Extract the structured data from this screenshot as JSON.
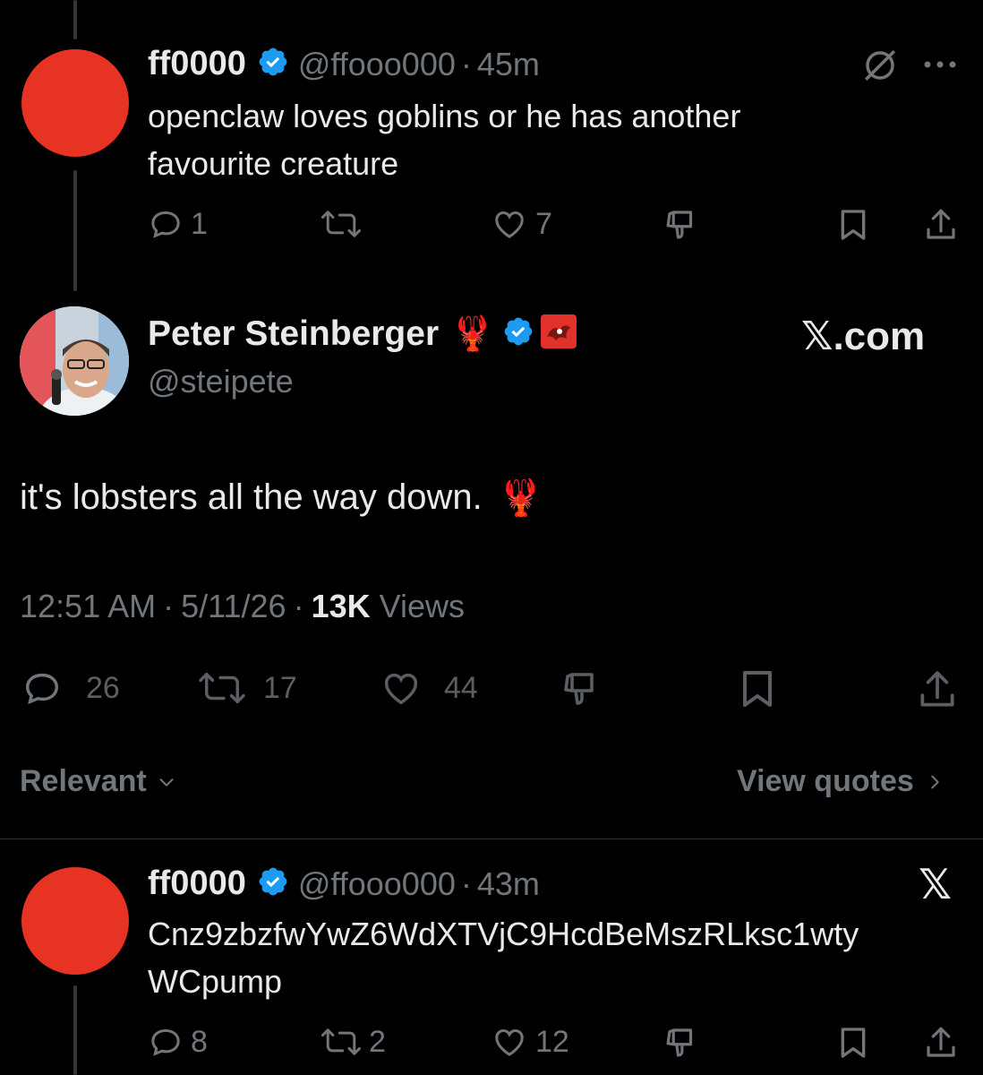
{
  "colors": {
    "background": "#000000",
    "text_primary": "#e7e9ea",
    "text_secondary": "#71767b",
    "verified_blue": "#1d9bf0",
    "avatar_red": "#e63323"
  },
  "tweet1": {
    "name": "ff0000",
    "handle": "@ffooo000",
    "separator": "·",
    "time": "45m",
    "text_line1": "openclaw loves goblins or he has another",
    "text_line2": "favourite creature",
    "actions": {
      "replies": "1",
      "reposts": "",
      "likes": "7"
    },
    "icons": [
      "block-icon",
      "more-icon"
    ]
  },
  "main_tweet": {
    "name": "Peter Steinberger",
    "name_emoji": "🦞",
    "handle": "@steipete",
    "source_label": "𝕏.com",
    "text": "it's lobsters all the way down.",
    "text_emoji": "🦞",
    "time": "12:51 AM",
    "separator": "·",
    "date": "5/11/26",
    "views_count": "13K",
    "views_label": "Views",
    "actions": {
      "replies": "26",
      "reposts": "17",
      "likes": "44"
    }
  },
  "sort": {
    "label": "Relevant",
    "view_quotes": "View quotes"
  },
  "tweet2": {
    "name": "ff0000",
    "handle": "@ffooo000",
    "separator": "·",
    "time": "43m",
    "text_line1": "Cnz9zbzfwYwZ6WdXTVjC9HcdBeMszRLksc1wty",
    "text_line2": "WCpump",
    "x_logo": "𝕏",
    "actions": {
      "replies": "8",
      "reposts": "2",
      "likes": "12"
    }
  }
}
